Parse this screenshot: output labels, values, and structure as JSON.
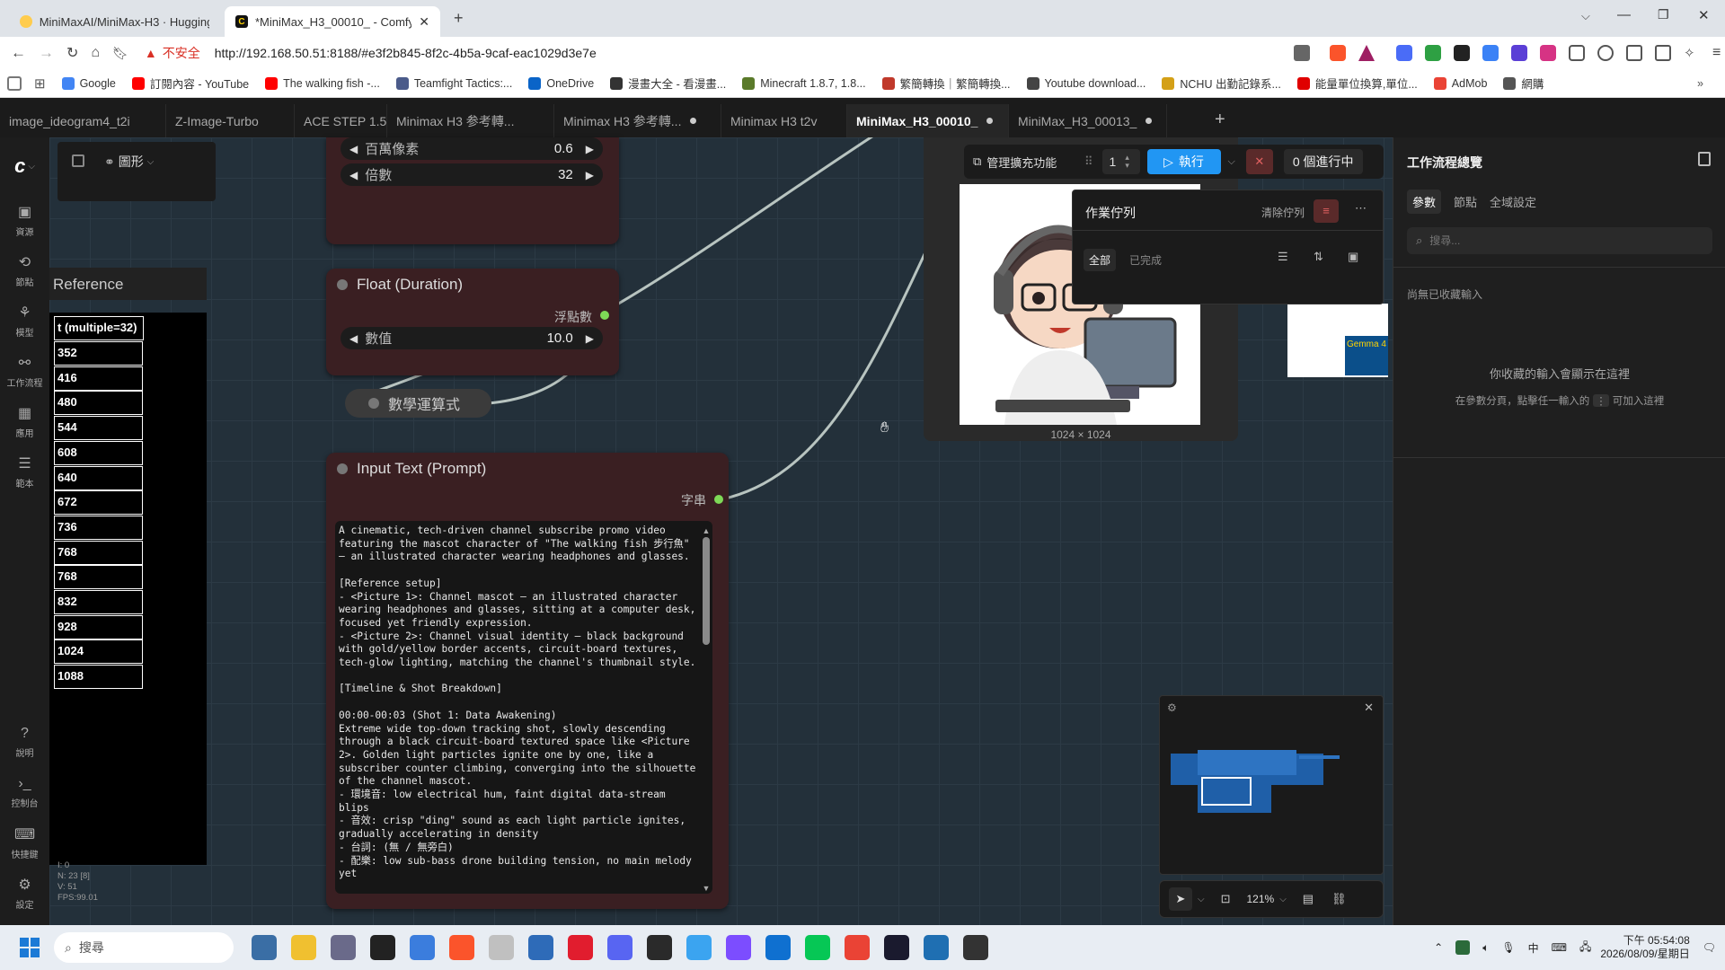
{
  "browser": {
    "tabs": [
      {
        "label": "MiniMaxAI/MiniMax-H3 · Hugging"
      },
      {
        "label": "*MiniMax_H3_00010_ - Comfy"
      }
    ],
    "new_tab": "+",
    "address_warning": "不安全",
    "url": "http://192.168.50.51:8188/#e3f2b845-8f2c-4b5a-9caf-eac1029d3e7e",
    "bookmarks": [
      {
        "label": "Google",
        "color": "#4285f4"
      },
      {
        "label": "訂閱內容 - YouTube",
        "color": "#ff0000"
      },
      {
        "label": "The walking fish -...",
        "color": "#ff0000"
      },
      {
        "label": "Teamfight Tactics:...",
        "color": "#4b5b8a"
      },
      {
        "label": "OneDrive",
        "color": "#0a64c8"
      },
      {
        "label": "漫畫大全 - 看漫畫...",
        "color": "#333333"
      },
      {
        "label": "Minecraft 1.8.7, 1.8...",
        "color": "#5a7a2a"
      },
      {
        "label": "繁簡轉換｜繁簡轉換...",
        "color": "#c0392b"
      },
      {
        "label": "Youtube download...",
        "color": "#444444"
      },
      {
        "label": "NCHU 出勤記錄系...",
        "color": "#d4a017"
      },
      {
        "label": "能量單位換算,單位...",
        "color": "#e00000"
      },
      {
        "label": "AdMob",
        "color": "#ea4335"
      },
      {
        "label": "網購",
        "color": "#555555"
      }
    ]
  },
  "app_tabs": [
    {
      "label": "image_ideogram4_t2i",
      "modified": false
    },
    {
      "label": "Z-Image-Turbo",
      "modified": false
    },
    {
      "label": "ACE STEP 1.5",
      "modified": false
    },
    {
      "label": "Minimax H3 参考轉...",
      "modified": false
    },
    {
      "label": "Minimax H3 参考轉...",
      "modified": true
    },
    {
      "label": "Minimax H3 t2v",
      "modified": false
    },
    {
      "label": "MiniMax_H3_00010_",
      "modified": true,
      "active": true
    },
    {
      "label": "MiniMax_H3_00013_",
      "modified": true
    }
  ],
  "canvas_menu": {
    "view_label": "圖形"
  },
  "left_sidebar": [
    {
      "label": "資源",
      "icon": "images-icon"
    },
    {
      "label": "節點",
      "icon": "nodes-icon"
    },
    {
      "label": "模型",
      "icon": "model-icon"
    },
    {
      "label": "工作流程",
      "icon": "workflow-icon"
    },
    {
      "label": "應用",
      "icon": "apps-icon"
    },
    {
      "label": "範本",
      "icon": "templates-icon"
    }
  ],
  "left_sidebar_bottom": [
    {
      "label": "說明",
      "icon": "help-icon"
    },
    {
      "label": "控制台",
      "icon": "terminal-icon"
    },
    {
      "label": "快捷鍵",
      "icon": "keyboard-icon"
    },
    {
      "label": "設定",
      "icon": "settings-icon"
    }
  ],
  "nodes": {
    "upscale": {
      "widgets": [
        {
          "label": "百萬像素",
          "value": "0.6"
        },
        {
          "label": "倍數",
          "value": "32"
        }
      ]
    },
    "float": {
      "title": "Float (Duration)",
      "output": "浮點數",
      "widget": {
        "label": "數值",
        "value": "10.0"
      }
    },
    "math": {
      "title": "數學運算式"
    },
    "prompt": {
      "title": "Input Text (Prompt)",
      "output": "字串",
      "text": "A cinematic, tech-driven channel subscribe promo video\nfeaturing the mascot character of \"The walking fish 步行魚\"\n— an illustrated character wearing headphones and glasses.\n\n[Reference setup]\n- <Picture 1>: Channel mascot — an illustrated character\nwearing headphones and glasses, sitting at a computer desk,\nfocused yet friendly expression.\n- <Picture 2>: Channel visual identity — black background\nwith gold/yellow border accents, circuit-board textures,\ntech-glow lighting, matching the channel's thumbnail style.\n\n[Timeline & Shot Breakdown]\n\n00:00-00:03 (Shot 1: Data Awakening)\nExtreme wide top-down tracking shot, slowly descending\nthrough a black circuit-board textured space like <Picture\n2>. Golden light particles ignite one by one, like a\nsubscriber counter climbing, converging into the silhouette\nof the channel mascot.\n- 環境音: low electrical hum, faint digital data-stream\nblips\n- 音效: crisp \"ding\" sound as each light particle ignites,\ngradually accelerating in density\n- 台詞: (無 / 無旁白)\n- 配樂: low sub-bass drone building tension, no main melody\nyet"
    },
    "reference": {
      "title": "Reference",
      "header": "t (multiple=32)",
      "values": [
        "352",
        "416",
        "480",
        "544",
        "608",
        "640",
        "672",
        "736",
        "768",
        "768",
        "832",
        "928",
        "1024",
        "1088"
      ]
    },
    "image_preview": {
      "size_label": "1024 × 1024"
    },
    "thumb_label": "Gemma 4"
  },
  "debug": [
    "N: 23 [8]",
    "V: 51",
    "FPS:99.01",
    "I: 0"
  ],
  "toolbar": {
    "manage_label": "管理擴充功能",
    "batch_count": "1",
    "run_label": "執行",
    "running_label": "0 個進行中"
  },
  "queue_panel": {
    "title": "作業佇列",
    "clear_label": "清除佇列",
    "filter_all": "全部",
    "filter_done": "已完成"
  },
  "right_panel": {
    "title": "工作流程總覽",
    "tabs": [
      "參數",
      "節點",
      "全域設定"
    ],
    "search_placeholder": "搜尋...",
    "empty_title": "尚無已收藏輸入",
    "empty_desc": "你收藏的輸入會顯示在這裡",
    "hint_pre": "在參數分頁，點擊任一輸入的",
    "hint_post": "可加入這裡"
  },
  "canvas_bottom": {
    "zoom": "121%"
  },
  "taskbar": {
    "search_label": "搜尋",
    "time": "下午 05:54:08",
    "date": "2026/08/09/星期日",
    "lang": "中",
    "apps": [
      {
        "color": "#3a6ea5"
      },
      {
        "color": "#f0c030"
      },
      {
        "color": "#6a6a8a"
      },
      {
        "color": "#222222"
      },
      {
        "color": "#3b7ddd"
      },
      {
        "color": "#fb542b"
      },
      {
        "color": "#c0c0c0"
      },
      {
        "color": "#2e6bb8"
      },
      {
        "color": "#e11d2e"
      },
      {
        "color": "#5865f2"
      },
      {
        "color": "#2a2a2a"
      },
      {
        "color": "#3ba4f0"
      },
      {
        "color": "#7c4dff"
      },
      {
        "color": "#0f70d0"
      },
      {
        "color": "#06c755"
      },
      {
        "color": "#ea4335"
      },
      {
        "color": "#1a1a2e"
      },
      {
        "color": "#1f6fb2"
      },
      {
        "color": "#333333"
      }
    ]
  }
}
